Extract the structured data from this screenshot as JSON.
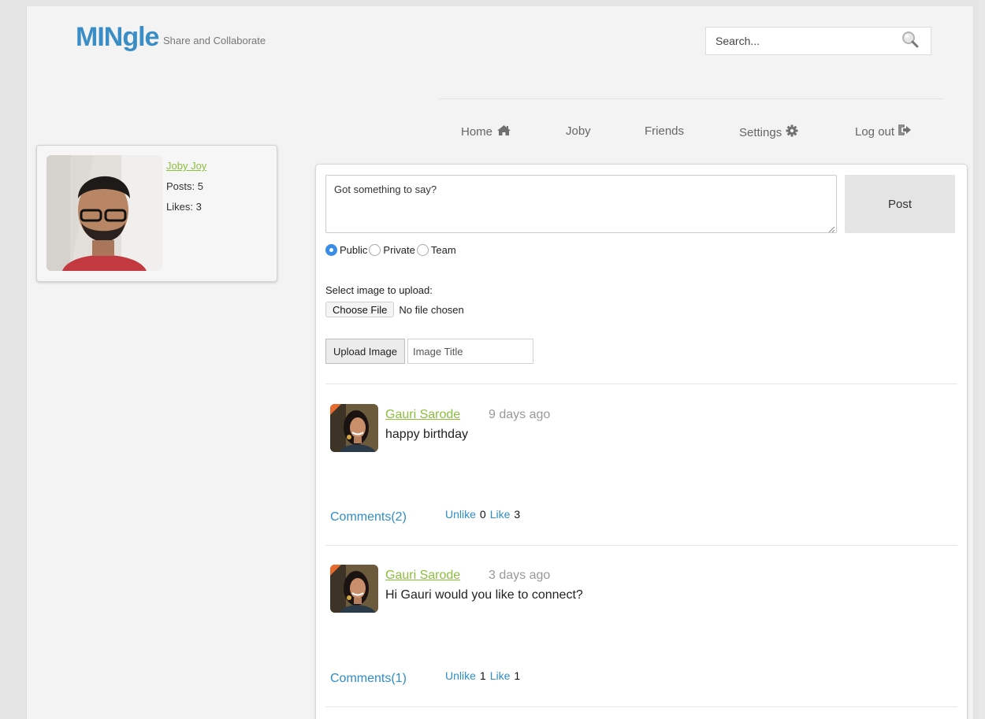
{
  "brand": {
    "name": "MINgle",
    "tagline": "Share and Collaborate",
    "accent": "#3b8dc6"
  },
  "search": {
    "placeholder": "Search...",
    "icon": "search-icon"
  },
  "nav": [
    {
      "label": "Home",
      "icon": "home-icon"
    },
    {
      "label": "Joby",
      "icon": ""
    },
    {
      "label": "Friends",
      "icon": ""
    },
    {
      "label": "Settings",
      "icon": "gear-icon"
    },
    {
      "label": "Log out",
      "icon": "logout-icon"
    }
  ],
  "profile": {
    "name": "Joby Joy",
    "posts": "Posts: 5",
    "likes": "Likes: 3",
    "name_color": "#8bbf3c"
  },
  "composer": {
    "placeholder": "Got something to say?",
    "post_label": "Post",
    "visibility": [
      {
        "label": "Public",
        "checked": true
      },
      {
        "label": "Private",
        "checked": false
      },
      {
        "label": "Team",
        "checked": false
      }
    ],
    "upload_prompt": "Select image to upload:",
    "choose_file_label": "Choose File",
    "file_status": "No file chosen",
    "upload_button_label": "Upload Image",
    "image_title_placeholder": "Image Title"
  },
  "posts": [
    {
      "author": "Gauri Sarode",
      "time": "9 days ago",
      "text": "happy birthday",
      "comments_label": "Comments(2)",
      "unlike_label": "Unlike",
      "unlike_count": "0",
      "like_label": "Like",
      "like_count": "3"
    },
    {
      "author": "Gauri Sarode",
      "time": "3 days ago",
      "text": "Hi Gauri would you like to connect?",
      "comments_label": "Comments(1)",
      "unlike_label": "Unlike",
      "unlike_count": "1",
      "like_label": "Like",
      "like_count": "1"
    }
  ]
}
